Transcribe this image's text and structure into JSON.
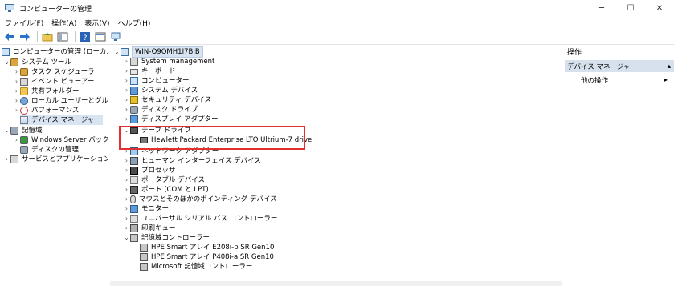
{
  "window": {
    "title": "コンピューターの管理",
    "minimize": "─",
    "maximize": "☐",
    "close": "✕"
  },
  "menu": [
    "ファイル(F)",
    "操作(A)",
    "表示(V)",
    "ヘルプ(H)"
  ],
  "toolbar": {
    "icons": [
      "back-arrow-icon",
      "forward-arrow-icon",
      "up-folder-icon",
      "show-hide-tree-icon",
      "help-icon",
      "properties-icon",
      "monitor-icon"
    ]
  },
  "left_tree": {
    "root": "コンピューターの管理 (ローカル)",
    "system_tools": "システム ツール",
    "task_scheduler": "タスク スケジューラ",
    "event_viewer": "イベント ビューアー",
    "shared_folders": "共有フォルダー",
    "local_users": "ローカル ユーザーとグループ",
    "performance": "パフォーマンス",
    "device_manager": "デバイス マネージャー",
    "storage": "記憶域",
    "windows_server_backup": "Windows Server バックア",
    "disk_management": "ディスクの管理",
    "services_apps": "サービスとアプリケーション"
  },
  "device_tree": {
    "computer": "WIN-Q9QMH1I7BIB",
    "categories": [
      "System management",
      "キーボード",
      "コンピューター",
      "システム デバイス",
      "セキュリティ デバイス",
      "ディスク ドライブ",
      "ディスプレイ アダプター",
      "テープ ドライブ",
      "Hewlett Packard Enterprise LTO Ultrium-7 drive",
      "ネットワーク アダプター",
      "ヒューマン インターフェイス デバイス",
      "プロセッサ",
      "ポータブル デバイス",
      "ポート (COM と LPT)",
      "マウスとそのほかのポインティング デバイス",
      "モニター",
      "ユニバーサル シリアル バス コントローラー",
      "印刷キュー",
      "記憶域コントローラー",
      "HPE Smart アレイ E208i-p SR Gen10",
      "HPE Smart アレイ P408i-a SR Gen10",
      "Microsoft 記憶域コントローラー"
    ]
  },
  "actions": {
    "title": "操作",
    "section": "デバイス マネージャー",
    "other": "他の操作",
    "arrow": "▸"
  },
  "colors": {
    "highlight_border": "#e03030",
    "selected_bg": "#d9e4f2",
    "section_bg": "#d7e1ee"
  }
}
